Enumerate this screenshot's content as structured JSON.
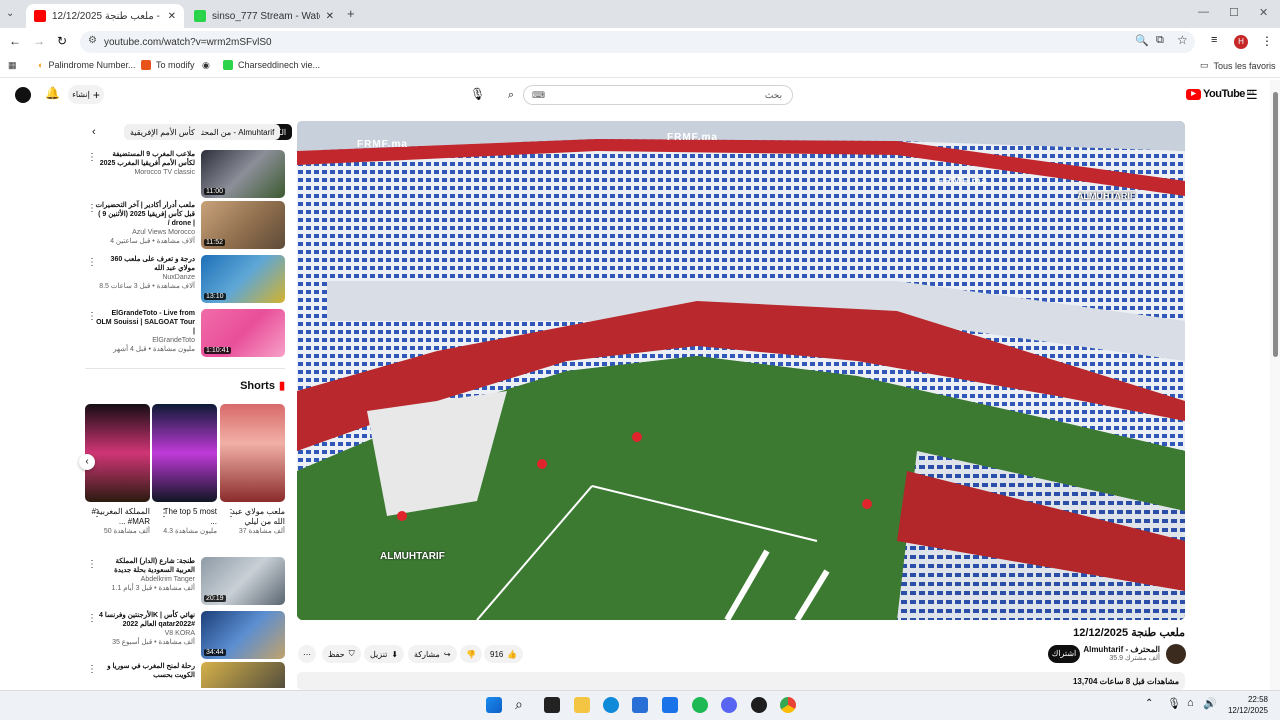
{
  "tabs": [
    {
      "title": "12/12/2025 ملعب طنجة - e",
      "active": true
    },
    {
      "title": "sinso_777 Stream - Watch Live -",
      "active": false
    }
  ],
  "new_tab": "+",
  "address": "youtube.com/watch?v=wrm2mSFvlS0",
  "bookmarks": [
    "Palindrome Number...",
    "To modify",
    "Charseddinech vie...",
    "Tous les favoris"
  ],
  "yt": {
    "logo": "YouTube",
    "country": "MA",
    "search_text": "بحث",
    "create_label": "إنشاء"
  },
  "chips": [
    "الكل",
    "من المحترف - Almuhtarif",
    "كأس الأمم الإفريقية"
  ],
  "videos": [
    {
      "title": "ملاعب المغرب 9 المستضيفة لكأس الأمم أفريقيا المغرب 2025",
      "channel": "Morocco TV classic",
      "meta": "",
      "duration": "11:00"
    },
    {
      "title": "ملعب أدرار أكادير | آخر التحضيرات قبل كأس إفريقيا 2025 (الأثنين 9 ) / drone |",
      "channel": "Azul Views Morocco",
      "meta": "4 آلاف مشاهدة • قبل ساعتين",
      "duration": "11:52"
    },
    {
      "title": "360 درجة و تعرف على ملعب مولاي عبد الله",
      "channel": "NuxDanze",
      "meta": "8.5 آلاف مشاهدة • قبل 3 ساعات",
      "duration": "13:10"
    },
    {
      "title": "ElGrandeToto - Live from OLM Souissi | SALGOAT Tour |",
      "channel": "ElGrandeToto",
      "meta": "مليون مشاهدة • قبل 4 أشهر",
      "duration": "1:10:41"
    }
  ],
  "shorts_title": "Shorts",
  "shorts": [
    {
      "title": "ملعب مولاي عبد الله من ليلي",
      "views": "37 ألف مشاهدة"
    },
    {
      "title": "The top 5 most ...",
      "views": "4.3 مليون مشاهدة"
    },
    {
      "title": "#المملكة المغربية ... #MAR",
      "views": "50 ألف مشاهدة"
    }
  ],
  "videos2": [
    {
      "title": "طنجة: شارع (الدار) المملكة العربية السعودية بحلة جديدة",
      "channel": "Abdelkrim Tanger",
      "meta": "1.1 ألف مشاهدة • قبل 3 أيام",
      "duration": "20:19"
    },
    {
      "title": "الأرجنتين وفرنسا 4K | نهائي كأس العالم 2022 qatar2022#",
      "channel": "V8 KORA",
      "meta": "35 ألف مشاهدة • قبل أسبوع",
      "duration": "34:44"
    },
    {
      "title": "رحلة لمنح المغرب في سوريا و الكويت بحسب",
      "channel": "",
      "meta": "",
      "duration": ""
    }
  ],
  "player": {
    "watermark1": "ALMUHTARIF",
    "watermark2": "ALMUHTARIF",
    "banner": "FRMF.ma"
  },
  "video": {
    "title": "ملعب طنجة 12/12/2025",
    "channel": "Almuhtarif - المحترف",
    "subs": "35.9 ألف مشترك",
    "subscribe": "اشتراك",
    "likes": "916",
    "share": "مشاركة",
    "download": "تنزيل",
    "clip": "حفظ",
    "views_meta": "13,704 مشاهدات قبل 8 ساعات"
  },
  "clock": {
    "time": "22:58",
    "date": "12/12/2025"
  }
}
